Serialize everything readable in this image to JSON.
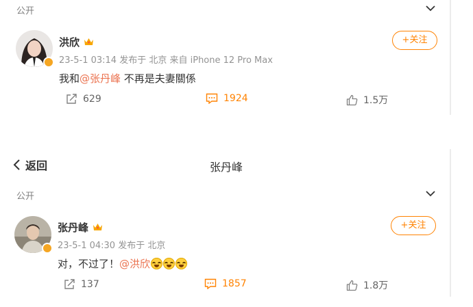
{
  "posts": [
    {
      "visibility": "公开",
      "username": "洪欣",
      "time": "23-5-1 03:14",
      "published_in": "发布于 北京",
      "source": "来自 iPhone 12 Pro Max",
      "content_before": "我和",
      "mention": "@张丹峰",
      "content_after": " 不再是夫妻關係",
      "follow_label": "+关注",
      "share_count": "629",
      "comment_count": "1924",
      "like_count": "1.5万"
    },
    {
      "visibility": "公开",
      "username": "张丹峰",
      "time": "23-5-1 04:30",
      "published_in": "发布于 北京",
      "content_before": "对，不过了！",
      "mention": "@洪欣",
      "emoji_name": "laugh-cry-emoji",
      "follow_label": "+关注",
      "share_count": "137",
      "comment_count": "1857",
      "like_count": "1.8万"
    }
  ],
  "nav": {
    "back_label": "返回",
    "page_title": "张丹峰"
  },
  "colors": {
    "accent": "#ff8200",
    "mention": "#eb7350",
    "badge": "#f5a623"
  }
}
